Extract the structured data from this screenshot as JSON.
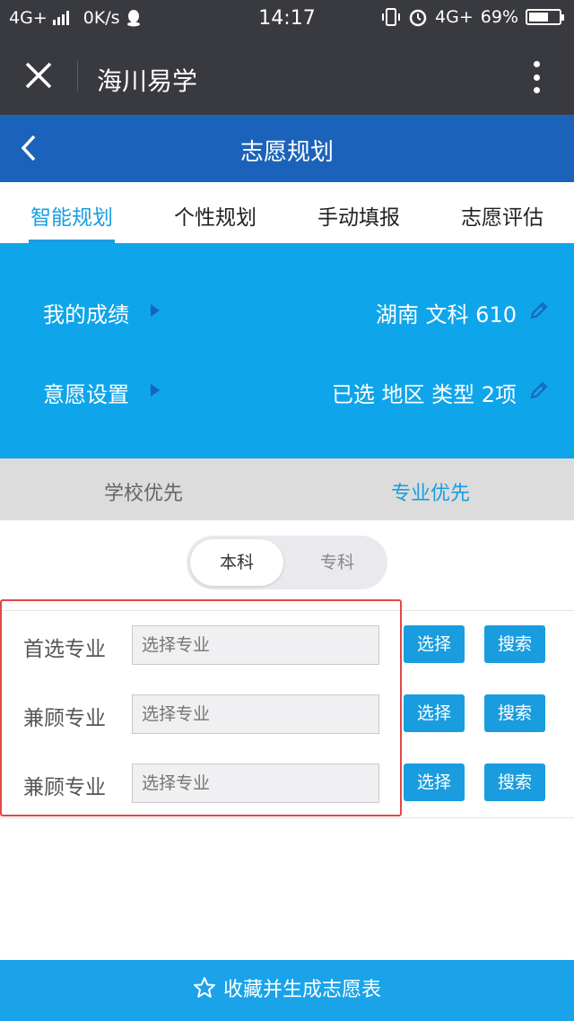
{
  "status_bar": {
    "network": "4G+",
    "speed": "0K/s",
    "time": "14:17",
    "network_right": "4G+",
    "battery_percent": "69%",
    "battery_level": 0.69
  },
  "wechat_bar": {
    "title": "海川易学"
  },
  "header": {
    "title": "志愿规划"
  },
  "tabs": [
    {
      "label": "智能规划",
      "active": true
    },
    {
      "label": "个性规划",
      "active": false
    },
    {
      "label": "手动填报",
      "active": false
    },
    {
      "label": "志愿评估",
      "active": false
    }
  ],
  "score_panel": {
    "score": {
      "label": "我的成绩",
      "value": "湖南  文科  610"
    },
    "preference": {
      "label": "意愿设置",
      "value": "已选  地区   类型  2项"
    }
  },
  "priority": {
    "school": "学校优先",
    "major": "专业优先",
    "active": "major"
  },
  "level": {
    "undergraduate": "本科",
    "vocational": "专科",
    "active": "undergraduate"
  },
  "majors": [
    {
      "label": "首选专业",
      "placeholder": "选择专业",
      "select_label": "选择",
      "search_label": "搜索"
    },
    {
      "label": "兼顾专业",
      "placeholder": "选择专业",
      "select_label": "选择",
      "search_label": "搜索"
    },
    {
      "label": "兼顾专业",
      "placeholder": "选择专业",
      "select_label": "选择",
      "search_label": "搜索"
    }
  ],
  "footer": {
    "label": "收藏并生成志愿表"
  },
  "colors": {
    "dark_bar": "#393a3f",
    "header_blue": "#1b63ba",
    "accent": "#1a9ddf",
    "panel_blue": "#0fa5ea",
    "highlight": "#e34747"
  }
}
